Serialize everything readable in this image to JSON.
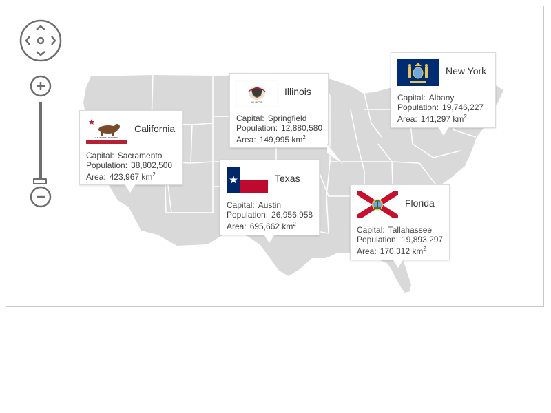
{
  "map": {
    "controls": {
      "pan": "pan-arrows-icon",
      "zoom_in": "plus-icon",
      "zoom_out": "minus-icon"
    },
    "colors": {
      "land": "#d9d9d9",
      "border": "#ffffff",
      "control": "#6e6e6e"
    }
  },
  "labels": {
    "capital": "Capital:",
    "population": "Population:",
    "area": "Area:",
    "area_unit": "km",
    "area_unit_exp": "2"
  },
  "states": [
    {
      "name": "California",
      "capital": "Sacramento",
      "population": "38,802,500",
      "area": "423,967",
      "flag": "california-flag-icon"
    },
    {
      "name": "Illinois",
      "capital": "Springfield",
      "population": "12,880,580",
      "area": "149,995",
      "flag": "illinois-flag-icon"
    },
    {
      "name": "Texas",
      "capital": "Austin",
      "population": "26,956,958",
      "area": "695,662",
      "flag": "texas-flag-icon"
    },
    {
      "name": "New York",
      "capital": "Albany",
      "population": "19,746,227",
      "area": "141,297",
      "flag": "new-york-flag-icon"
    },
    {
      "name": "Florida",
      "capital": "Tallahassee",
      "population": "19,893,297",
      "area": "170,312",
      "flag": "florida-flag-icon"
    }
  ]
}
